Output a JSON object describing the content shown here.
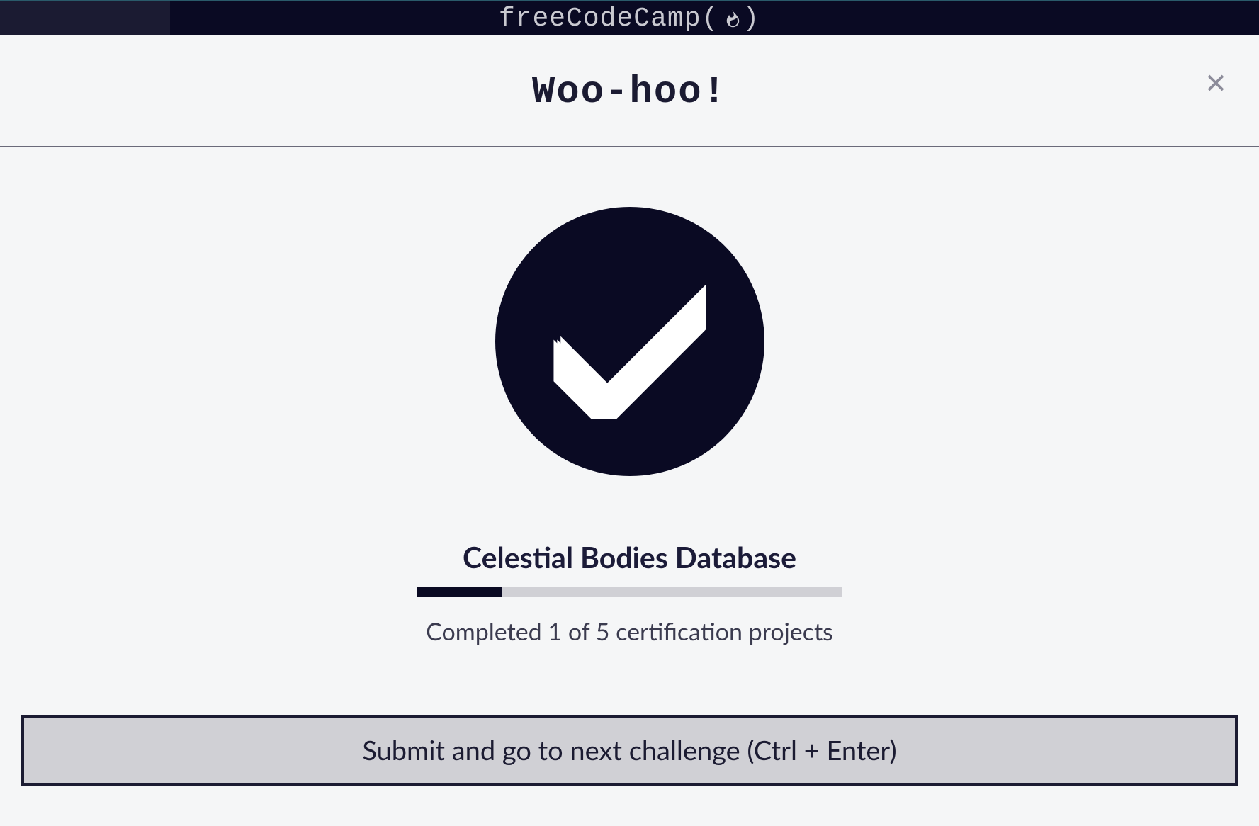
{
  "header": {
    "brand_text": "freeCodeCamp"
  },
  "modal": {
    "title": "Woo-hoo!",
    "project_title": "Celestial Bodies Database",
    "progress_text": "Completed 1 of 5 certification projects",
    "progress_percent": 20,
    "submit_label": "Submit and go to next challenge (Ctrl + Enter)"
  },
  "colors": {
    "dark_navy": "#0a0a23",
    "light_gray_bg": "#f5f6f7",
    "button_bg": "#d0d0d5",
    "text_dark": "#1b1b32"
  }
}
